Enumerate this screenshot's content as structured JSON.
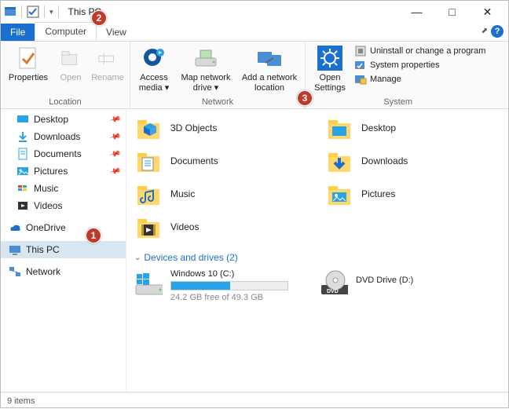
{
  "window": {
    "title": "This PC",
    "min": "—",
    "max": "□",
    "close": "✕"
  },
  "tabs": {
    "file": "File",
    "computer": "Computer",
    "view": "View"
  },
  "ribbon": {
    "location": {
      "label": "Location",
      "properties": "Properties",
      "open": "Open",
      "rename": "Rename"
    },
    "network": {
      "label": "Network",
      "access_media": "Access media ▾",
      "map_drive": "Map network drive ▾",
      "add_location": "Add a network location"
    },
    "system": {
      "label": "System",
      "open_settings": "Open Settings",
      "uninstall": "Uninstall or change a program",
      "properties": "System properties",
      "manage": "Manage"
    }
  },
  "sidebar": {
    "desktop": "Desktop",
    "downloads": "Downloads",
    "documents": "Documents",
    "pictures": "Pictures",
    "music": "Music",
    "videos": "Videos",
    "onedrive": "OneDrive",
    "thispc": "This PC",
    "network": "Network"
  },
  "folders": {
    "objects3d": "3D Objects",
    "desktop": "Desktop",
    "documents": "Documents",
    "downloads": "Downloads",
    "music": "Music",
    "pictures": "Pictures",
    "videos": "Videos"
  },
  "section": {
    "devices": "Devices and drives (2)"
  },
  "drives": {
    "c": {
      "name": "Windows 10 (C:)",
      "free": "24.2 GB free of 49.3 GB",
      "fill_pct": 51
    },
    "d": {
      "name": "DVD Drive (D:)"
    }
  },
  "status": {
    "items": "9 items"
  },
  "annotations": {
    "one": "1",
    "two": "2",
    "three": "3"
  }
}
